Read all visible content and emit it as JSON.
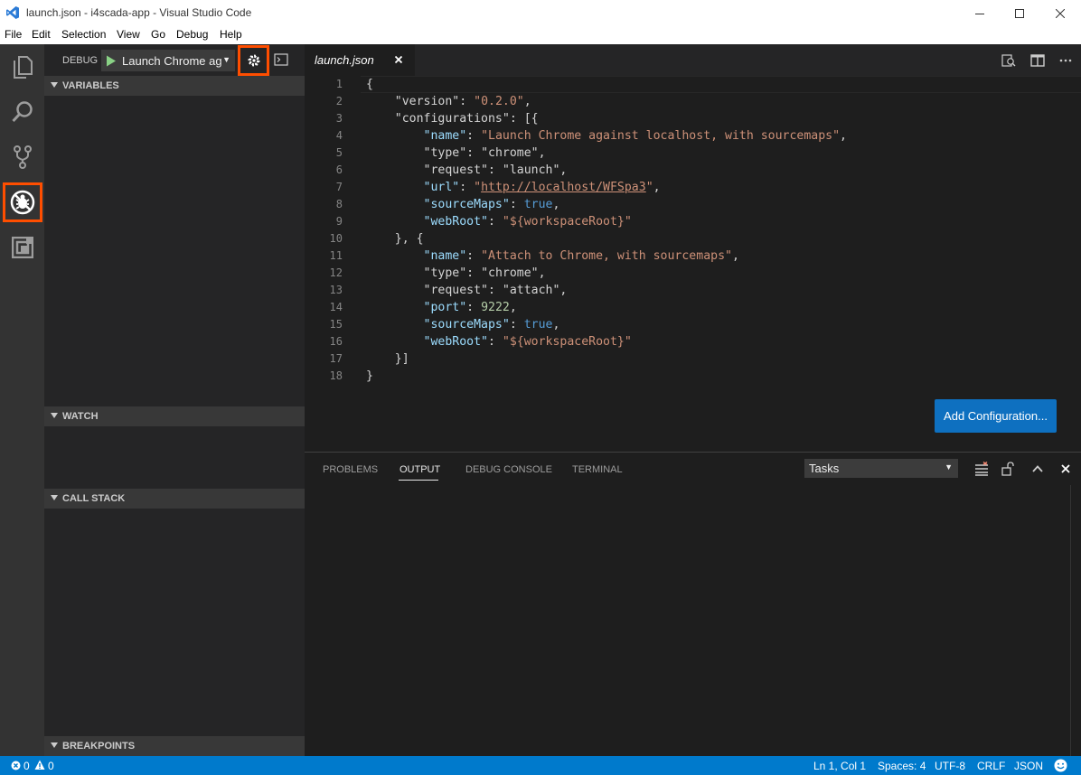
{
  "window": {
    "title": "launch.json - i4scada-app - Visual Studio Code"
  },
  "menu": [
    "File",
    "Edit",
    "Selection",
    "View",
    "Go",
    "Debug",
    "Help"
  ],
  "debug": {
    "label": "DEBUG",
    "configuration": "Launch Chrome ag",
    "highlight_color": "#ff4e00"
  },
  "sidebar": {
    "sections": [
      "VARIABLES",
      "WATCH",
      "CALL STACK",
      "BREAKPOINTS"
    ]
  },
  "editor": {
    "tab_label": "launch.json",
    "line_numbers": [
      "1",
      "2",
      "3",
      "4",
      "5",
      "6",
      "7",
      "8",
      "9",
      "10",
      "11",
      "12",
      "13",
      "14",
      "15",
      "16",
      "17",
      "18"
    ],
    "add_config_label": "Add Configuration...",
    "accent_button_color": "#0e70c0"
  },
  "code": {
    "l1_open": "{",
    "l2_key": "\"version\"",
    "l2_val": "\"0.2.0\"",
    "l3_key": "\"configurations\"",
    "l3_rest": ": [{",
    "l4_key": "\"name\"",
    "l4_val": "\"Launch Chrome against localhost, with sourcemaps\"",
    "l5_key": "\"type\"",
    "l5_val": "\"chrome\"",
    "l6_key": "\"request\"",
    "l6_val": "\"launch\"",
    "l7_key": "\"url\"",
    "l7_q": "\"",
    "l7_url": "http://localhost/WFSpa3",
    "l8_key": "\"sourceMaps\"",
    "l8_val": "true",
    "l9_key": "\"webRoot\"",
    "l9_val": "\"${workspaceRoot}\"",
    "l10": "}, {",
    "l11_key": "\"name\"",
    "l11_val": "\"Attach to Chrome, with sourcemaps\"",
    "l12_key": "\"type\"",
    "l12_val": "\"chrome\"",
    "l13_key": "\"request\"",
    "l13_val": "\"attach\"",
    "l14_key": "\"port\"",
    "l14_val": "9222",
    "l15_key": "\"sourceMaps\"",
    "l15_val": "true",
    "l16_key": "\"webRoot\"",
    "l16_val": "\"${workspaceRoot}\"",
    "l17": "}]",
    "l18": "}",
    "sep_colon": ": ",
    "sep_comma": ","
  },
  "panel": {
    "tabs": [
      "PROBLEMS",
      "OUTPUT",
      "DEBUG CONSOLE",
      "TERMINAL"
    ],
    "active_tab": "OUTPUT",
    "select_value": "Tasks"
  },
  "status": {
    "errors": "0",
    "warnings": "0",
    "position": "Ln 1, Col 1",
    "spaces": "Spaces: 4",
    "encoding": "UTF-8",
    "eol": "CRLF",
    "language": "JSON",
    "bar_color": "#007acc"
  }
}
